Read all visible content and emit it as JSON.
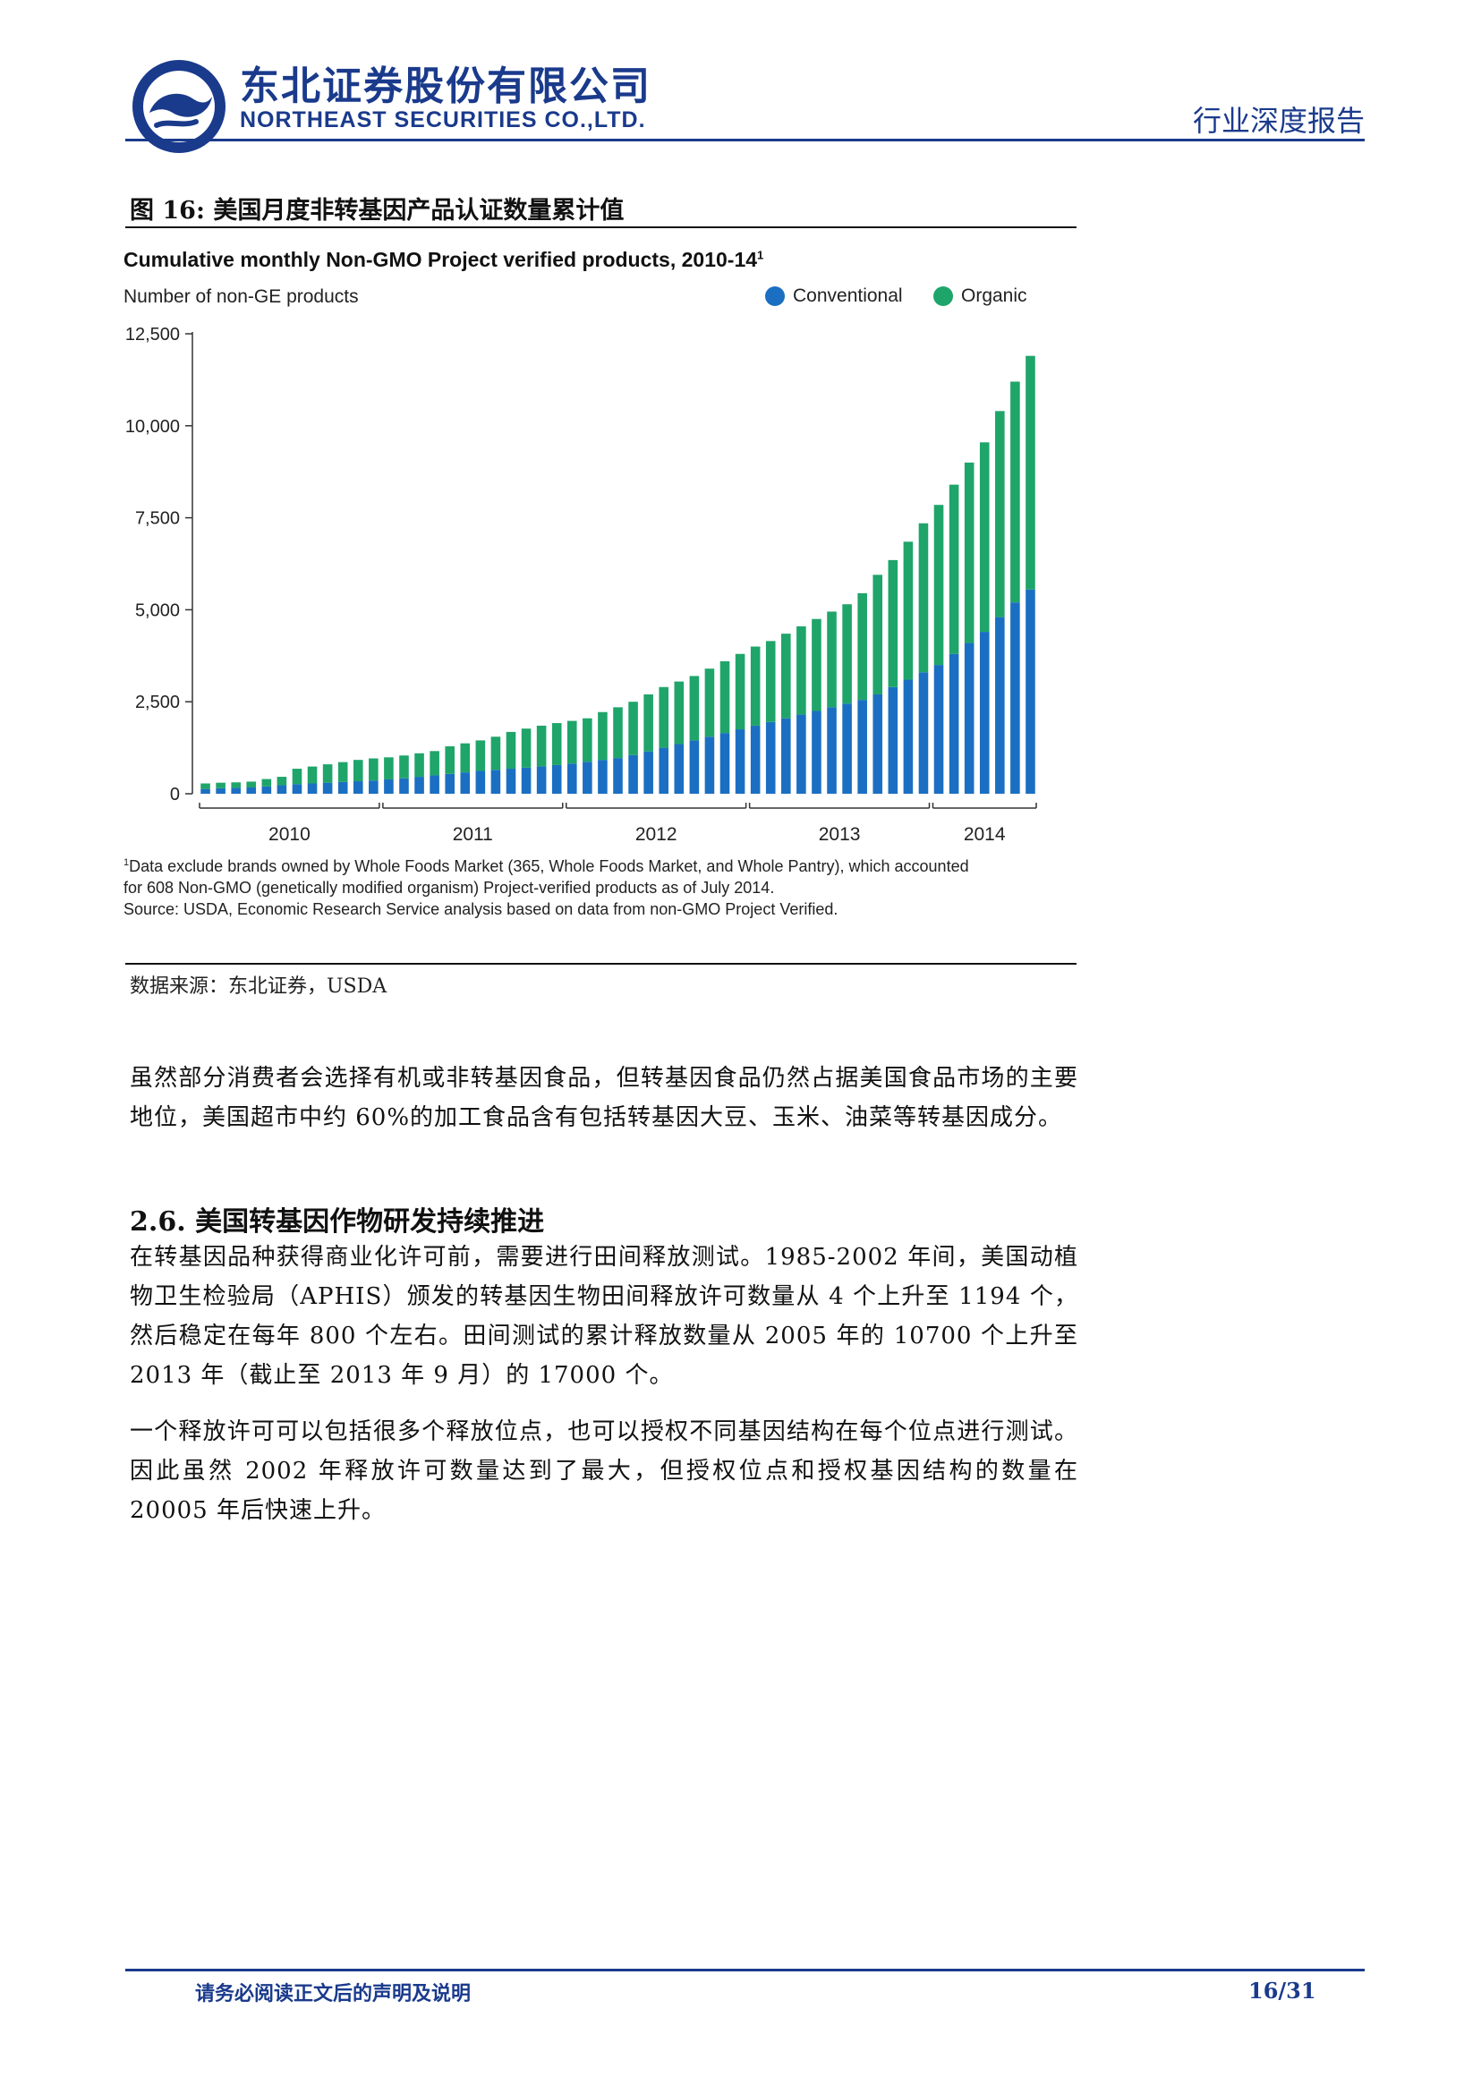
{
  "header": {
    "company_cn": "东北证券股份有限公司",
    "company_en": "NORTHEAST SECURITIES CO.,LTD.",
    "report_type": "行业深度报告",
    "brand_color": "#1a3a8c"
  },
  "figure": {
    "caption": "图 16: 美国月度非转基因产品认证数量累计值",
    "source": "数据来源：东北证券，USDA"
  },
  "chart_data": {
    "type": "bar",
    "stacked": true,
    "title": "Cumulative monthly Non-GMO Project verified products, 2010-14",
    "title_sup": "1",
    "ylabel": "Number of non-GE products",
    "xlabel": "",
    "ylim": [
      0,
      12500
    ],
    "yticks": [
      0,
      2500,
      5000,
      7500,
      10000,
      12500
    ],
    "ytick_labels": [
      "0",
      "2,500",
      "5,000",
      "7,500",
      "10,000",
      "12,500"
    ],
    "x_groups": [
      {
        "label": "2010",
        "count": 12
      },
      {
        "label": "2011",
        "count": 12
      },
      {
        "label": "2012",
        "count": 12
      },
      {
        "label": "2013",
        "count": 12
      },
      {
        "label": "2014",
        "count": 7
      }
    ],
    "legend_position": "top-right",
    "grid": false,
    "series": [
      {
        "name": "Conventional",
        "color": "#1b6fc2",
        "values": [
          130,
          150,
          160,
          170,
          200,
          230,
          260,
          280,
          300,
          320,
          340,
          360,
          390,
          420,
          460,
          500,
          540,
          580,
          620,
          650,
          680,
          710,
          740,
          780,
          820,
          870,
          920,
          970,
          1050,
          1150,
          1250,
          1350,
          1450,
          1550,
          1650,
          1750,
          1850,
          1950,
          2050,
          2150,
          2250,
          2350,
          2450,
          2550,
          2700,
          2900,
          3100,
          3300,
          3500,
          3800,
          4100,
          4400,
          4800,
          5200,
          5550
        ]
      },
      {
        "name": "Organic",
        "color": "#1fa56a",
        "values": [
          150,
          150,
          150,
          160,
          200,
          230,
          420,
          460,
          500,
          540,
          580,
          600,
          600,
          620,
          640,
          660,
          750,
          790,
          830,
          900,
          1000,
          1060,
          1110,
          1140,
          1160,
          1180,
          1300,
          1380,
          1450,
          1550,
          1650,
          1700,
          1750,
          1850,
          1950,
          2050,
          2150,
          2200,
          2300,
          2400,
          2500,
          2600,
          2700,
          2900,
          3250,
          3450,
          3750,
          4050,
          4350,
          4600,
          4900,
          5150,
          5600,
          6000,
          6350
        ]
      }
    ],
    "footnotes": [
      "Data exclude brands owned by Whole Foods Market (365, Whole Foods Market, and Whole Pantry), which accounted",
      "for 608 Non-GMO (genetically modified organism) Project-verified products as of July 2014.",
      "Source: USDA, Economic Research Service analysis based on data from non-GMO Project Verified."
    ],
    "footnote_marker": "1"
  },
  "body": {
    "para1": "虽然部分消费者会选择有机或非转基因食品，但转基因食品仍然占据美国食品市场的主要地位，美国超市中约 60%的加工食品含有包括转基因大豆、玉米、油菜等转基因成分。",
    "section_heading": "2.6. 美国转基因作物研发持续推进",
    "para2": "在转基因品种获得商业化许可前，需要进行田间释放测试。1985-2002 年间，美国动植物卫生检验局（APHIS）颁发的转基因生物田间释放许可数量从 4 个上升至 1194 个，然后稳定在每年 800 个左右。田间测试的累计释放数量从 2005 年的 10700 个上升至 2013 年（截止至 2013 年 9 月）的 17000 个。",
    "para3": "一个释放许可可以包括很多个释放位点，也可以授权不同基因结构在每个位点进行测试。因此虽然 2002 年释放许可数量达到了最大，但授权位点和授权基因结构的数量在 20005 年后快速上升。"
  },
  "footer": {
    "note": "请务必阅读正文后的声明及说明",
    "page": "16/31"
  }
}
